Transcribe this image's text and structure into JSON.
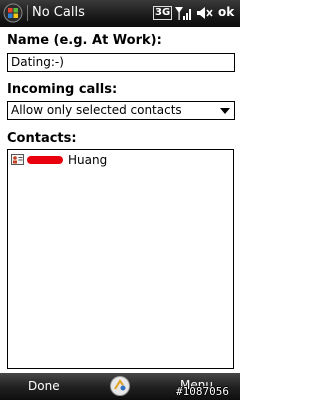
{
  "titlebar": {
    "title": "No Calls",
    "network": "3G",
    "ok_label": "ok",
    "icons": [
      "windows-start-icon",
      "signal-strength-icon",
      "speaker-muted-icon"
    ]
  },
  "form": {
    "name_label": "Name (e.g. At Work):",
    "name_value": "Dating:-)",
    "incoming_label": "Incoming calls:",
    "incoming_value": "Allow only selected contacts",
    "contacts_label": "Contacts:",
    "contacts": [
      {
        "name": "Huang",
        "icon": "contact-card-icon"
      }
    ]
  },
  "menubar": {
    "left_label": "Done",
    "right_label": "Menu",
    "center_icon": "keyboard-icon"
  },
  "watermark": "#1087056",
  "colors": {
    "bar_dark": "#1c1c1c",
    "redaction": "#e8000c"
  }
}
